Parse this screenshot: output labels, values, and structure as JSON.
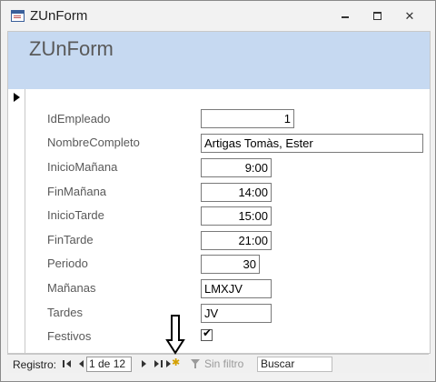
{
  "window": {
    "title": "ZUnForm",
    "controls": {
      "minimize": "minimize",
      "maximize": "maximize",
      "close": "✕"
    }
  },
  "form": {
    "heading": "ZUnForm",
    "fields": [
      {
        "label": "IdEmpleado",
        "value": "1",
        "align": "right"
      },
      {
        "label": "NombreCompleto",
        "value": "Artigas Tomàs,  Ester",
        "align": "left"
      },
      {
        "label": "InicioMañana",
        "value": "9:00",
        "align": "right"
      },
      {
        "label": "FinMañana",
        "value": "14:00",
        "align": "right"
      },
      {
        "label": "InicioTarde",
        "value": "15:00",
        "align": "right"
      },
      {
        "label": "FinTarde",
        "value": "21:00",
        "align": "right"
      },
      {
        "label": "Periodo",
        "value": "30",
        "align": "right"
      },
      {
        "label": "Mañanas",
        "value": "LMXJV",
        "align": "left"
      },
      {
        "label": "Tardes",
        "value": "JV",
        "align": "left"
      },
      {
        "label": "Festivos",
        "checked": true
      }
    ]
  },
  "navigation": {
    "label": "Registro:",
    "record": "1 de 12",
    "filter": "Sin filtro",
    "search_placeholder": "Buscar"
  }
}
